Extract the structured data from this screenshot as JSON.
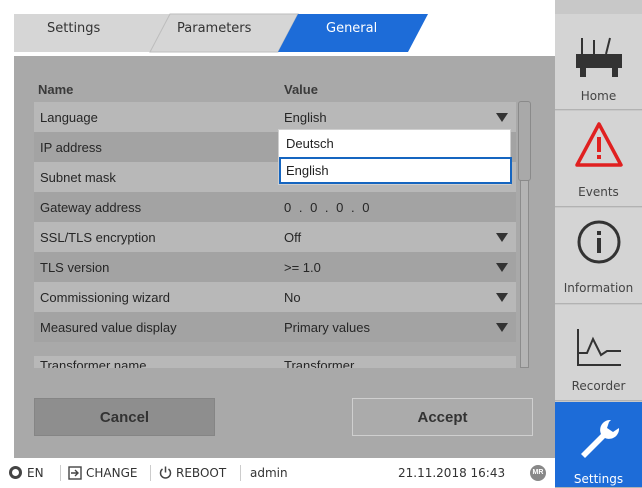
{
  "tabs": [
    {
      "label": "Settings",
      "active": false
    },
    {
      "label": "Parameters",
      "active": false
    },
    {
      "label": "General",
      "active": true
    }
  ],
  "table": {
    "col_name": "Name",
    "col_value": "Value",
    "rows": [
      {
        "name": "Language",
        "value": "English",
        "dropdown": true
      },
      {
        "name": "IP address",
        "value": "",
        "dropdown": false
      },
      {
        "name": "Subnet mask",
        "value": "",
        "dropdown": false
      },
      {
        "name": "Gateway address",
        "value": "0 . 0 . 0 . 0",
        "dropdown": false
      },
      {
        "name": "SSL/TLS encryption",
        "value": "Off",
        "dropdown": true
      },
      {
        "name": "TLS version",
        "value": ">= 1.0",
        "dropdown": true
      },
      {
        "name": "Commissioning wizard",
        "value": "No",
        "dropdown": true
      },
      {
        "name": "Measured value display",
        "value": "Primary values",
        "dropdown": true
      },
      {
        "name": "Transformer name",
        "value": "Transformer",
        "dropdown": false
      }
    ]
  },
  "dropdown": {
    "options": [
      "Deutsch",
      "English"
    ],
    "selected": "English"
  },
  "buttons": {
    "cancel": "Cancel",
    "accept": "Accept"
  },
  "status": {
    "language": "EN",
    "change": "CHANGE",
    "reboot": "REBOOT",
    "user": "admin",
    "datetime": "21.11.2018 16:43",
    "logo": "MR"
  },
  "nav": [
    {
      "label": "Home",
      "icon": "home-icon"
    },
    {
      "label": "Events",
      "icon": "warning-icon"
    },
    {
      "label": "Information",
      "icon": "info-icon"
    },
    {
      "label": "Recorder",
      "icon": "recorder-icon"
    },
    {
      "label": "Settings",
      "icon": "wrench-icon",
      "active": true
    }
  ],
  "colors": {
    "accent": "#1d6cd8",
    "panel": "#a9a9a9",
    "warning": "#e02020"
  }
}
